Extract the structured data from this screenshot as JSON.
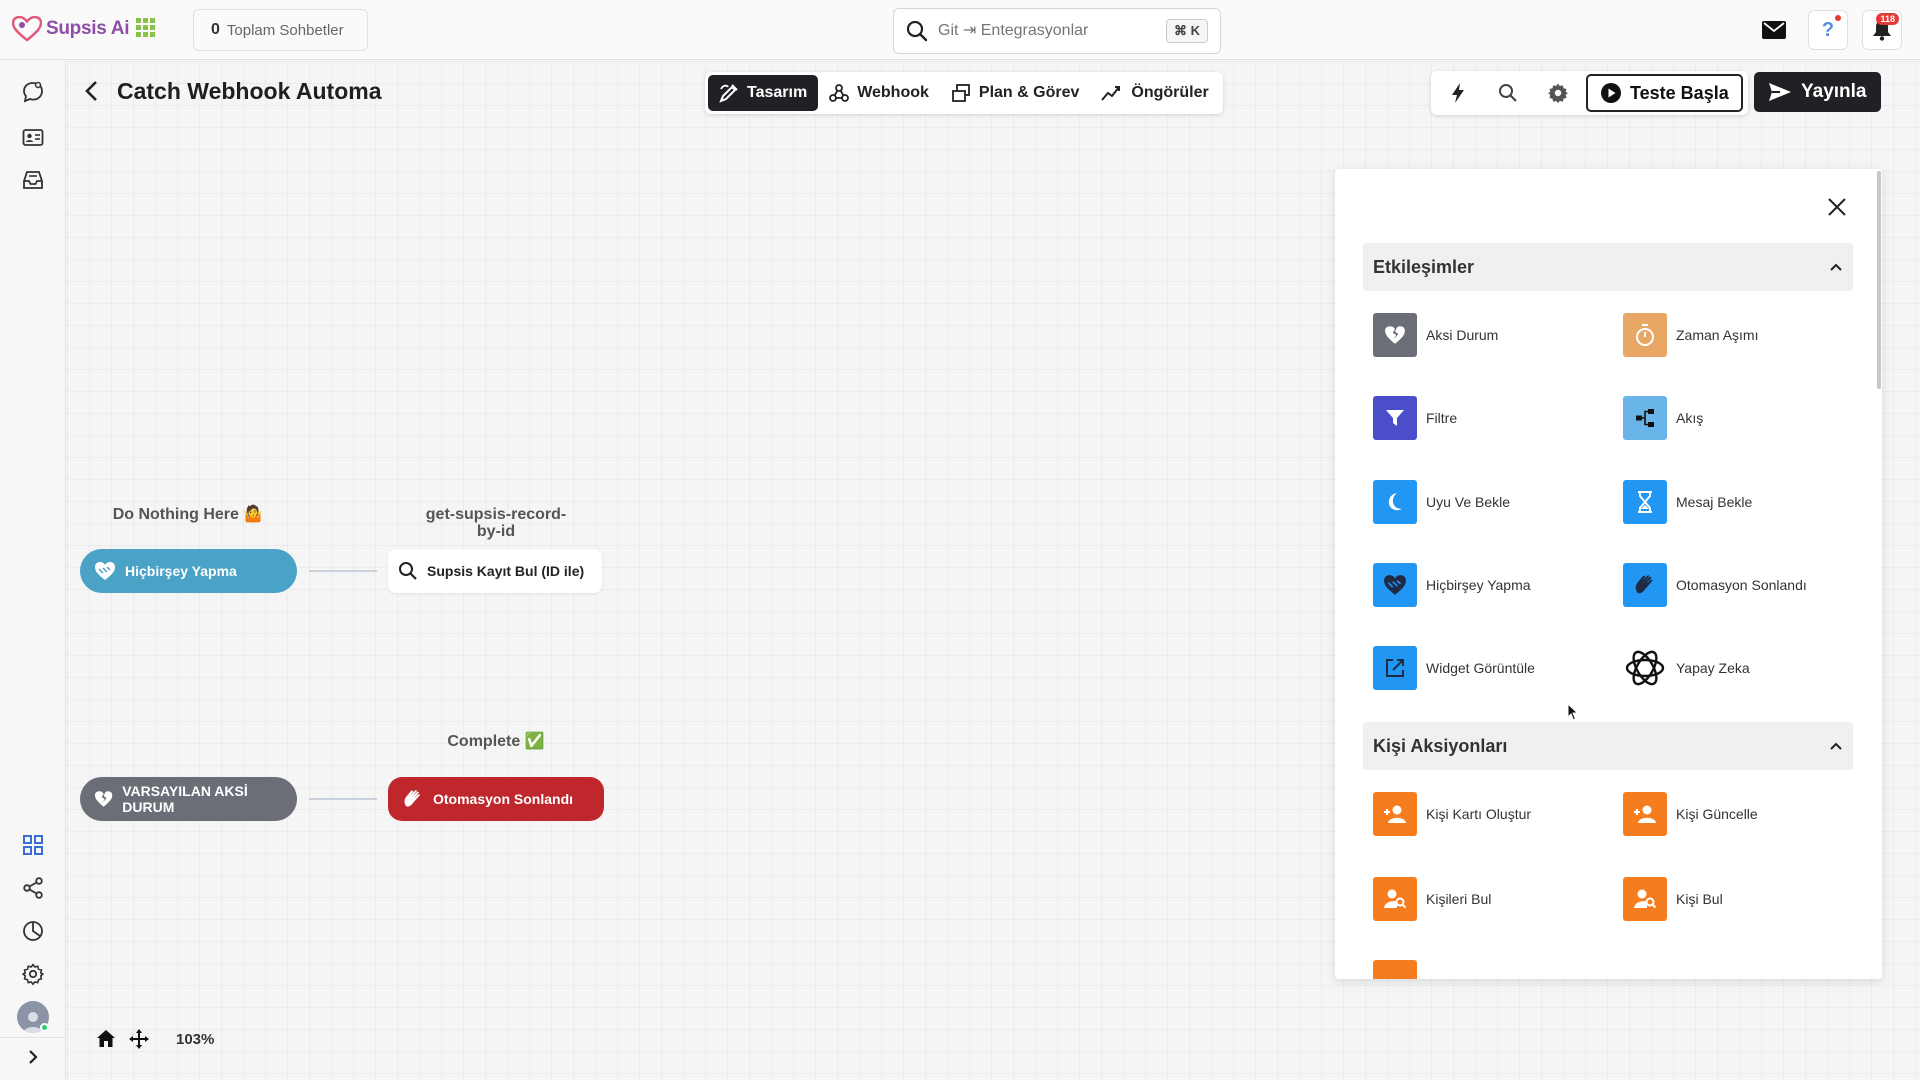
{
  "app": {
    "name": "Supsis Ai"
  },
  "topbar": {
    "chats_count": "0",
    "chats_label": "Toplam Sohbetler",
    "search_placeholder": "Git ⇥ Entegrasyonlar",
    "search_shortcut": "⌘ K",
    "notification_count": "118"
  },
  "editor": {
    "title": "Catch Webhook Automa",
    "tabs": [
      {
        "label": "Tasarım",
        "icon": "design-icon",
        "active": true
      },
      {
        "label": "Webhook",
        "icon": "webhook-icon",
        "active": false
      },
      {
        "label": "Plan & Görev",
        "icon": "plan-icon",
        "active": false
      },
      {
        "label": "Öngörüler",
        "icon": "insights-icon",
        "active": false
      }
    ],
    "test_label": "Teste Başla",
    "publish_label": "Yayınla"
  },
  "canvas": {
    "zoom": "103%",
    "nodes": [
      {
        "caption": "Do Nothing Here 🤷",
        "label": "Hiçbirşey Yapma",
        "color": "#4aa3c7"
      },
      {
        "caption": "get-supsis-record-by-id",
        "label": "Supsis Kayıt Bul (ID ile)",
        "color": "#ffffff"
      },
      {
        "caption": "",
        "label": "VARSAYILAN AKSİ DURUM",
        "color": "#6b6e76"
      },
      {
        "caption": "Complete ✅",
        "label": "Otomasyon Sonlandı",
        "color": "#c0272d"
      }
    ]
  },
  "panel": {
    "sections": [
      {
        "title": "Etkileşimler",
        "items": [
          {
            "label": "Aksi Durum",
            "icon": "broken-heart-icon",
            "color": "#6b6e76"
          },
          {
            "label": "Zaman Aşımı",
            "icon": "timer-icon",
            "color": "#e8a765"
          },
          {
            "label": "Filtre",
            "icon": "filter-icon",
            "color": "#4a4fc9"
          },
          {
            "label": "Akış",
            "icon": "flow-icon",
            "color": "#69b4e8"
          },
          {
            "label": "Uyu Ve Bekle",
            "icon": "moon-icon",
            "color": "#2196f3"
          },
          {
            "label": "Mesaj Bekle",
            "icon": "hourglass-icon",
            "color": "#2196f3"
          },
          {
            "label": "Hiçbirşey Yapma",
            "icon": "handshake-icon",
            "color": "#2196f3"
          },
          {
            "label": "Otomasyon Sonlandı",
            "icon": "clap-icon",
            "color": "#2196f3"
          },
          {
            "label": "Widget Görüntüle",
            "icon": "external-link-icon",
            "color": "#2196f3"
          },
          {
            "label": "Yapay Zeka",
            "icon": "ai-icon",
            "color": "#ffffff"
          }
        ]
      },
      {
        "title": "Kişi Aksiyonları",
        "items": [
          {
            "label": "Kişi Kartı Oluştur",
            "icon": "person-add-icon",
            "color": "#f57c1f"
          },
          {
            "label": "Kişi Güncelle",
            "icon": "person-edit-icon",
            "color": "#f57c1f"
          },
          {
            "label": "Kişileri Bul",
            "icon": "person-search-icon",
            "color": "#f57c1f"
          },
          {
            "label": "Kişi Bul",
            "icon": "person-search-icon",
            "color": "#f57c1f"
          }
        ]
      }
    ]
  }
}
